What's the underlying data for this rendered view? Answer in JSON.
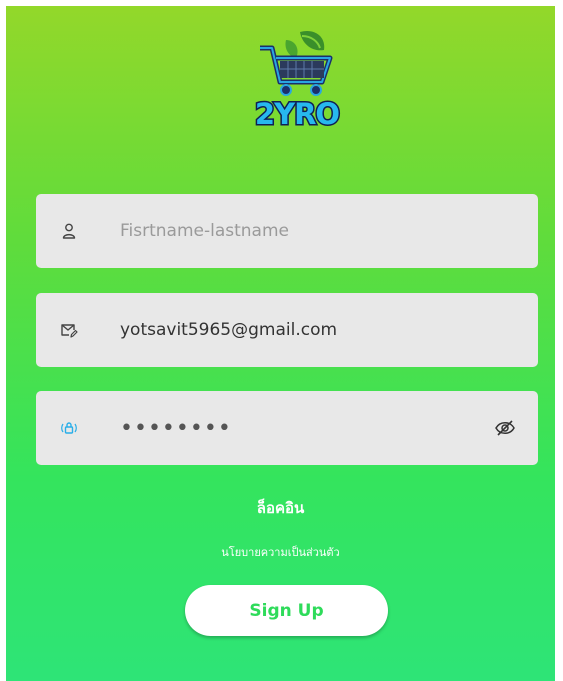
{
  "logo": {
    "text": "2YRO"
  },
  "fields": {
    "fullname": {
      "placeholder": "Fisrtname-lastname",
      "value": ""
    },
    "email": {
      "placeholder": "",
      "value": "yotsavit5965@gmail.com"
    },
    "password": {
      "value": "12345678"
    }
  },
  "links": {
    "login": "ล็อคอิน",
    "privacy": "นโยบายความเป็นส่วนตัว"
  },
  "buttons": {
    "signup": "Sign Up"
  },
  "colors": {
    "gradient_top": "#93d82a",
    "gradient_bottom": "#2ee477",
    "field_bg": "#e8e8e8",
    "button_text": "#2edb5a",
    "lock_icon": "#29aee8"
  },
  "icons": {
    "fullname": "user-icon",
    "email": "mail-edit-icon",
    "password": "lock-icon",
    "visibility": "eye-off-icon"
  }
}
